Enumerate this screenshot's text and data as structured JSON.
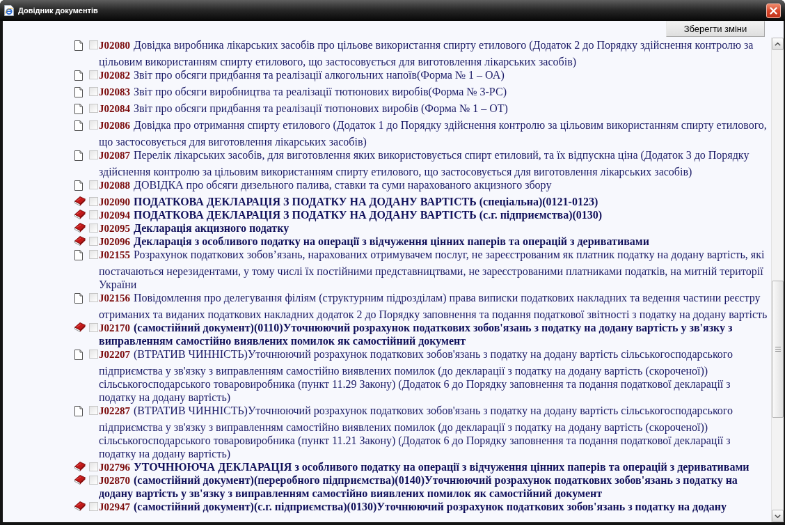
{
  "window": {
    "title": "Довідник документів"
  },
  "toolbar": {
    "save_button": "Зберегти зміни"
  },
  "documents": [
    {
      "kind": "page",
      "checked": false,
      "code": "J02080",
      "title": "Довідка виробника лікарських засобів про цільове використання спирту етилового (Додаток 2 до Порядку здійснення контролю за цільовим використанням спирту етилового, що застосовується для виготовлення лікарських засобів)"
    },
    {
      "kind": "page",
      "checked": false,
      "code": "J02082",
      "title": "Звіт про обсяги придбання та реалізації алкогольних напоїв(Форма № 1 – ОА)"
    },
    {
      "kind": "page",
      "checked": false,
      "code": "J02083",
      "title": "Звіт про обсяги виробництва та реалізації тютюнових виробів(Форма № 3-РС)"
    },
    {
      "kind": "page",
      "checked": false,
      "code": "J02084",
      "title": "Звіт про обсяги придбання та реалізації тютюнових виробів (Форма № 1 – ОТ)"
    },
    {
      "kind": "page",
      "checked": false,
      "code": "J02086",
      "title": "Довідка про отримання спирту етилового (Додаток 1 до Порядку здійснення контролю за цільовим використанням спирту етилового, що застосовується для виготовлення лікарських засобів)"
    },
    {
      "kind": "page",
      "checked": false,
      "code": "J02087",
      "title": "Перелік лікарських засобів, для виготовлення яких використовується спирт етиловий, та їх відпускна ціна (Додаток 3 до Порядку здійснення контролю за цільовим використанням спирту етилового, що застосовується для виготовлення лікарських засобів)"
    },
    {
      "kind": "page",
      "checked": false,
      "code": "J02088",
      "title": "ДОВІДКА про обсяги дизельного палива, ставки та суми нарахованого акцизного збору"
    },
    {
      "kind": "book",
      "checked": false,
      "code": "J02090",
      "title": "ПОДАТКОВА ДЕКЛАРАЦІЯ З ПОДАТКУ НА ДОДАНУ ВАРТІСТЬ (спеціальна)(0121-0123)"
    },
    {
      "kind": "book",
      "checked": false,
      "code": "J02094",
      "title": "ПОДАТКОВА ДЕКЛАРАЦІЯ З ПОДАТКУ НА ДОДАНУ ВАРТІСТЬ (с.г. підприємства)(0130)"
    },
    {
      "kind": "book",
      "checked": false,
      "code": "J02095",
      "title": "Декларація акцизного податку"
    },
    {
      "kind": "book",
      "checked": false,
      "code": "J02096",
      "title": "Декларація з особливого податку на операції з відчуження цінних паперів та операцій з деривативами"
    },
    {
      "kind": "page",
      "checked": false,
      "code": "J02155",
      "title": "Розрахунок податкових зобов’язань, нарахованих отримувачем послуг, не зареєстрованим як платник податку на додану вартість, які постачаються нерезидентами, у тому числі їх постійними представництвами, не зареєстрованими платниками податків, на митній території України"
    },
    {
      "kind": "page",
      "checked": false,
      "code": "J02156",
      "title": "Повідомлення про делегування філіям (структурним підрозділам) права виписки податкових накладних та ведення частини реєстру отриманих та виданих податкових накладних додаток 2 до Порядку заповнення та подання податкової звітності з податку на додану вартість"
    },
    {
      "kind": "book",
      "checked": false,
      "code": "J02170",
      "title": "(самостійний документ)(0110)Уточнюючий розрахунок податкових зобов'язань з податку на додану вартість у зв'язку з виправленням самостійно виявлених помилок як самостійний документ"
    },
    {
      "kind": "page",
      "checked": false,
      "code": "J02207",
      "title": "(ВТРАТИВ ЧИННІСТЬ)Уточнюючий розрахунок податкових зобов'язань з податку на додану вартість сільськогосподарського підприємства у зв'язку з виправленням самостійно виявлених помилок (до декларації з податку на додану вартість (скороченої)) сільськогосподарського товаровиробника (пункт 11.29 Закону) (Додаток 6 до Порядку заповнення та подання податкової декларації з податку на додану вартість)"
    },
    {
      "kind": "page",
      "checked": false,
      "code": "J02287",
      "title": "(ВТРАТИВ ЧИННІСТЬ)Уточнюючий розрахунок податкових зобов'язань з податку на додану вартість сільськогосподарського підприємства у зв'язку з виправленням самостійно виявлених помилок (до декларації з податку на додану вартість (скороченої)) сільськогосподарського товаровиробника (пункт 11.21 Закону) (Додаток 6 до Порядку заповнення та подання податкової декларації з податку на додану вартість)"
    },
    {
      "kind": "book",
      "checked": false,
      "code": "J02796",
      "title": "УТОЧНЮЮЧА ДЕКЛАРАЦІЯ з особливого податку на операції з відчуження цінних паперів та операцій з деривативами"
    },
    {
      "kind": "book",
      "checked": false,
      "code": "J02870",
      "title": "(самостійний документ)(переробного підприємства)(0140)Уточнюючий розрахунок податкових зобов'язань з податку на додану вартість у зв'язку з виправленням самостійно виявлених помилок як самостійний документ"
    },
    {
      "kind": "book",
      "checked": false,
      "code": "J02947",
      "title": "(самостійний документ)(с.г. підприємства)(0130)Уточнюючий розрахунок податкових зобов'язань з податку на додану"
    }
  ]
}
